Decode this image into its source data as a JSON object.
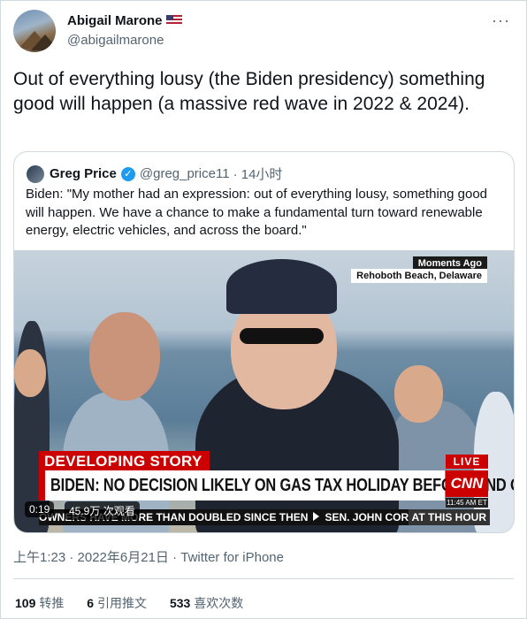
{
  "author": {
    "name": "Abigail Marone",
    "handle": "@abigailmarone",
    "flag_icon": "us-flag-icon"
  },
  "tweet": {
    "text": "Out of everything lousy (the Biden presidency) something good will happen (a massive red wave in 2022 & 2024).",
    "timestamp": "上午1:23 · 2022年6月21日 · Twitter for iPhone"
  },
  "quote": {
    "name": "Greg Price",
    "handle": "@greg_price11",
    "age": "· 14小时",
    "text": "Biden: \"My mother had an expression: out of everything lousy, something good will happen. We have a chance to make a fundamental turn toward renewable energy, electric vehicles, and across the board.\"",
    "video": {
      "moments_ago": "Moments Ago",
      "location": "Rehoboth Beach, Delaware",
      "banner": "DEVELOPING STORY",
      "headline": "BIDEN: NO DECISION LIKELY ON GAS TAX HOLIDAY BEFORE END OF WEEK",
      "live": "LIVE",
      "network": "CNN",
      "clock": "11:45 AM ET",
      "ticker_left": "OWNERS HAVE MORE THAN DOUBLED SINCE THEN",
      "ticker_right": "SEN. JOHN CORNYN, THE TOP REPUB",
      "ticker_end": "AT THIS HOUR",
      "duration": "0:19",
      "views": "45.9万 次观看"
    }
  },
  "stats": {
    "retweets_count": "109",
    "retweets_label": "转推",
    "quotes_count": "6",
    "quotes_label": "引用推文",
    "likes_count": "533",
    "likes_label": "喜欢次数"
  },
  "colors": {
    "accent": "#1d9bf0",
    "cnn_red": "#cc0000",
    "secondary_text": "#536471",
    "border": "#cfd9de"
  }
}
